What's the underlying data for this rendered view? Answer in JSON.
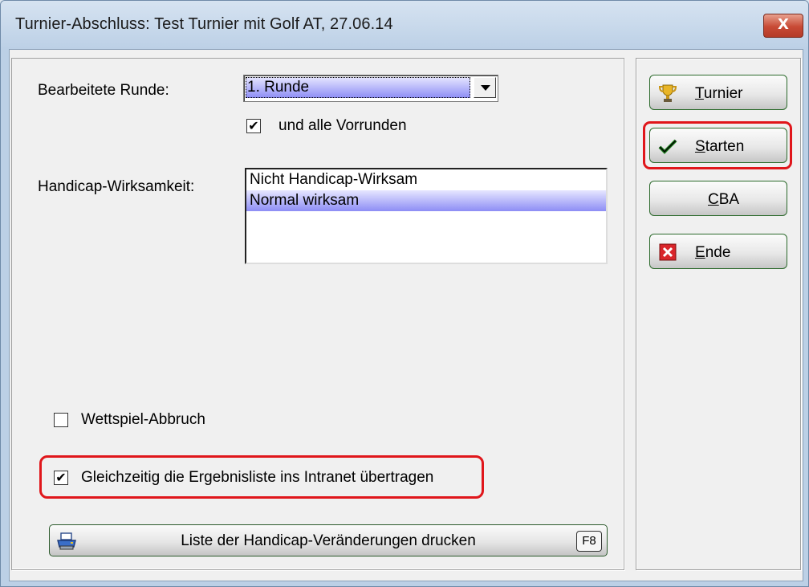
{
  "window": {
    "title": "Turnier-Abschluss: Test Turnier mit Golf AT, 27.06.14",
    "close_label": "X"
  },
  "form": {
    "round_label": "Bearbeitete Runde:",
    "round_value": "1. Runde",
    "include_previous_label": "und alle Vorrunden",
    "include_previous_checked": true,
    "handicap_label": "Handicap-Wirksamkeit:",
    "handicap_options": [
      "Nicht Handicap-Wirksam",
      "Normal wirksam"
    ],
    "handicap_selected_index": 1,
    "abort_label": "Wettspiel-Abbruch",
    "abort_checked": false,
    "intranet_label": "Gleichzeitig die Ergebnisliste ins Intranet übertragen",
    "intranet_checked": true,
    "print_button_label": "Liste der Handicap-Veränderungen drucken",
    "print_button_key": "F8"
  },
  "side_buttons": {
    "turnier": {
      "label_first": "T",
      "label_rest": "urnier",
      "icon": "trophy-icon"
    },
    "starten": {
      "label_first": "S",
      "label_rest": "tarten",
      "icon": "checkmark-icon"
    },
    "cba": {
      "label_first": "C",
      "label_rest": "BA"
    },
    "ende": {
      "label_first": "E",
      "label_rest": "nde",
      "icon": "red-x-icon"
    }
  },
  "colors": {
    "highlight_red": "#e0161b",
    "selection_blue": "#8d8df5",
    "button_border_green": "#2c6a2c"
  }
}
